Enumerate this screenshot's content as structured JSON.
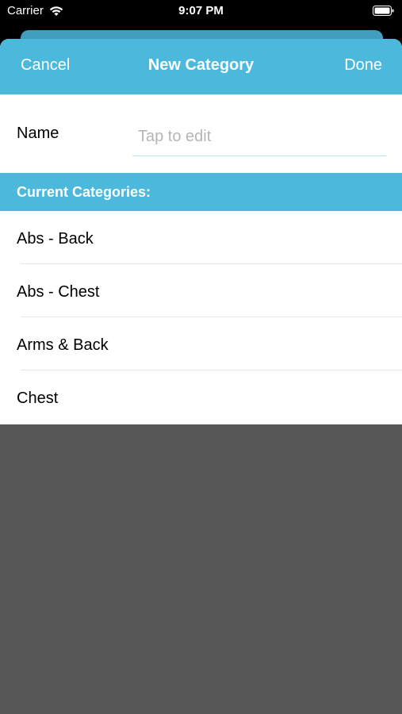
{
  "status_bar": {
    "carrier": "Carrier",
    "time": "9:07 PM"
  },
  "navbar": {
    "cancel_label": "Cancel",
    "title": "New Category",
    "done_label": "Done"
  },
  "form": {
    "name_label": "Name",
    "name_placeholder": "Tap to edit",
    "name_value": ""
  },
  "section": {
    "header": "Current Categories:"
  },
  "categories": [
    {
      "label": "Abs - Back"
    },
    {
      "label": "Abs - Chest"
    },
    {
      "label": "Arms & Back"
    },
    {
      "label": "Chest"
    }
  ],
  "colors": {
    "accent": "#4bb8dc",
    "overlay": "#575757"
  },
  "icons": {
    "wifi": "wifi-icon",
    "battery": "battery-icon"
  }
}
